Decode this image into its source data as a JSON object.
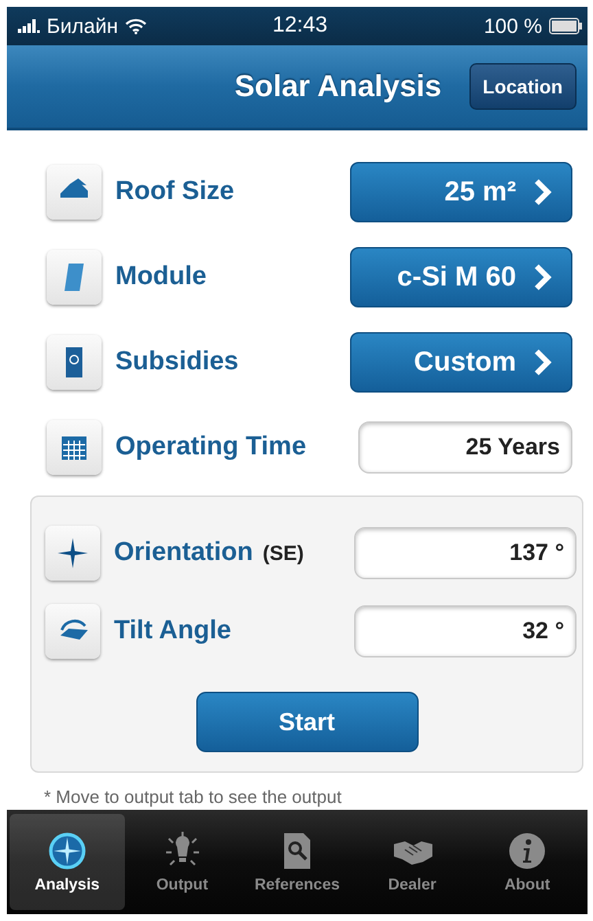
{
  "status_bar": {
    "carrier": "Билайн",
    "time": "12:43",
    "battery": "100 %"
  },
  "nav_bar": {
    "title": "Solar Analysis",
    "button": "Location"
  },
  "rows": [
    {
      "kind": "picker",
      "label": "Roof Size",
      "value": "25 m²"
    },
    {
      "kind": "picker",
      "label": "Module",
      "value": "c-Si M 60"
    },
    {
      "kind": "picker",
      "label": "Subsidies",
      "value": "Custom"
    },
    {
      "kind": "field",
      "label": "Operating Time",
      "value": "25 Years"
    }
  ],
  "panel": {
    "rows": [
      {
        "kind": "field",
        "label": "Orientation",
        "note": "(SE)",
        "value": "137 °"
      },
      {
        "kind": "field",
        "label": "Tilt Angle",
        "value": "32 °"
      }
    ],
    "button": "Start"
  },
  "footnote": "* Move to output tab to see the output",
  "tabs": [
    {
      "label": "Analysis",
      "selected": true
    },
    {
      "label": "Output",
      "selected": false
    },
    {
      "label": "References",
      "selected": false
    },
    {
      "label": "Dealer",
      "selected": false
    },
    {
      "label": "About",
      "selected": false
    }
  ]
}
